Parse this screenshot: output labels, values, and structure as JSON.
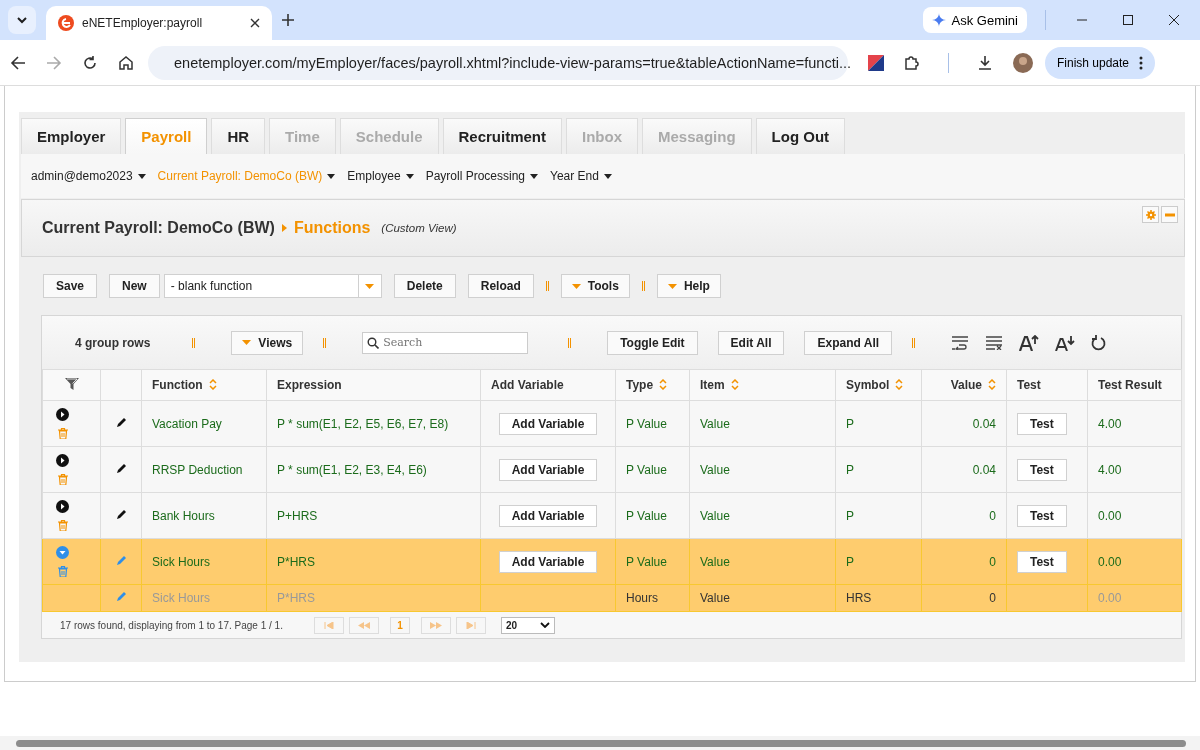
{
  "browser": {
    "tab_title": "eNETEmployer:payroll",
    "ask": "Ask Gemini",
    "url": "enetemployer.com/myEmployer/faces/payroll.xhtml?include-view-params=true&tableActionName=functi...",
    "update": "Finish update"
  },
  "tabs": [
    {
      "label": "Employer",
      "selected": false,
      "disabled": false
    },
    {
      "label": "Payroll",
      "selected": true,
      "disabled": false
    },
    {
      "label": "HR",
      "selected": false,
      "disabled": false
    },
    {
      "label": "Time",
      "selected": false,
      "disabled": true
    },
    {
      "label": "Schedule",
      "selected": false,
      "disabled": true
    },
    {
      "label": "Recruitment",
      "selected": false,
      "disabled": false
    },
    {
      "label": "Inbox",
      "selected": false,
      "disabled": true
    },
    {
      "label": "Messaging",
      "selected": false,
      "disabled": true
    },
    {
      "label": "Log Out",
      "selected": false,
      "disabled": false
    }
  ],
  "menu": [
    {
      "label": "admin@demo2023",
      "selected": false
    },
    {
      "label": "Current Payroll: DemoCo (BW)",
      "selected": true
    },
    {
      "label": "Employee",
      "selected": false
    },
    {
      "label": "Payroll Processing",
      "selected": false
    },
    {
      "label": "Year End",
      "selected": false
    }
  ],
  "breadcrumb": {
    "parent": "Current Payroll: DemoCo (BW)",
    "current": "Functions",
    "note": "(Custom View)"
  },
  "toolbar": {
    "save": "Save",
    "new": "New",
    "function_select": "- blank function",
    "delete": "Delete",
    "reload": "Reload",
    "tools": "Tools",
    "help": "Help"
  },
  "grid": {
    "group_rows": "4 group rows",
    "views": "Views",
    "search_placeholder": "Search",
    "toggle_edit": "Toggle Edit",
    "edit_all": "Edit All",
    "expand_all": "Expand All"
  },
  "columns": [
    {
      "label": "Function",
      "sortable": true
    },
    {
      "label": "Expression",
      "sortable": false
    },
    {
      "label": "Add Variable",
      "sortable": false
    },
    {
      "label": "Type",
      "sortable": true
    },
    {
      "label": "Item",
      "sortable": true
    },
    {
      "label": "Symbol",
      "sortable": true
    },
    {
      "label": "Value",
      "sortable": true
    },
    {
      "label": "Test",
      "sortable": false
    },
    {
      "label": "Test Result",
      "sortable": false
    }
  ],
  "rows": [
    {
      "kind": "group",
      "expanded": false,
      "selected": false,
      "function": "Vacation Pay",
      "expression": "P * sum(E1, E2, E5, E6, E7, E8)",
      "add_variable": "Add Variable",
      "type": "P Value",
      "item": "Value",
      "symbol": "P",
      "value": "0.04",
      "test": "Test",
      "test_result": "4.00"
    },
    {
      "kind": "group",
      "expanded": false,
      "selected": false,
      "function": "RRSP Deduction",
      "expression": "P * sum(E1, E2, E3, E4, E6)",
      "add_variable": "Add Variable",
      "type": "P Value",
      "item": "Value",
      "symbol": "P",
      "value": "0.04",
      "test": "Test",
      "test_result": "4.00"
    },
    {
      "kind": "group",
      "expanded": false,
      "selected": false,
      "function": "Bank Hours",
      "expression": "P+HRS",
      "add_variable": "Add Variable",
      "type": "P Value",
      "item": "Value",
      "symbol": "P",
      "value": "0",
      "test": "Test",
      "test_result": "0.00"
    },
    {
      "kind": "group",
      "expanded": true,
      "selected": true,
      "function": "Sick Hours",
      "expression": "P*HRS",
      "add_variable": "Add Variable",
      "type": "P Value",
      "item": "Value",
      "symbol": "P",
      "value": "0",
      "test": "Test",
      "test_result": "0.00"
    },
    {
      "kind": "detail",
      "selected": true,
      "function": "Sick Hours",
      "expression": "P*HRS",
      "type": "Hours",
      "item": "Value",
      "symbol": "HRS",
      "value": "0",
      "test_result": "0.00"
    }
  ],
  "footer": {
    "status": "17 rows found, displaying from 1 to 17. Page 1 / 1.",
    "page": "1",
    "page_size": "20"
  }
}
